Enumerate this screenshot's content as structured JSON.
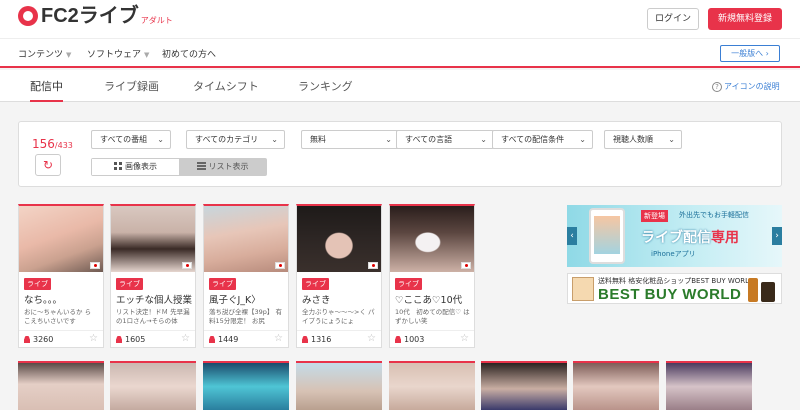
{
  "header": {
    "logo_main": "FC2ライブ",
    "logo_sub": "アダルト",
    "login_label": "ログイン",
    "register_label": "新規無料登録"
  },
  "nav": {
    "items": [
      {
        "label": "コンテンツ"
      },
      {
        "label": "ソフトウェア"
      },
      {
        "label": "初めての方へ"
      }
    ],
    "general_label": "一般版へ ›"
  },
  "tabs": [
    {
      "label": "配信中",
      "active": true
    },
    {
      "label": "ライブ録画"
    },
    {
      "label": "タイムシフト"
    },
    {
      "label": "ランキング"
    }
  ],
  "help_label": "アイコンの説明",
  "filters": {
    "count": "156",
    "total": "/433",
    "selects": [
      "すべての番組",
      "すべてのカテゴリ",
      "無料",
      "すべての言語",
      "すべての配信条件",
      "視聴人数順"
    ],
    "view_image_label": "画像表示",
    "view_list_label": "リスト表示"
  },
  "live_badge": "ライブ",
  "cards": [
    {
      "title": "なち。。。",
      "desc": "おに〜ちゃんいるか ら　こえちいさいです",
      "viewers": "3260"
    },
    {
      "title": "エッチな個人授業",
      "desc": "リスト決定！ドＭ 先早漏 の1ロさん→そらの体",
      "viewers": "1605"
    },
    {
      "title": "風子ぐJ_K〉",
      "desc": "落ち説び全裸【39p】 有料15分限定！ お尻",
      "viewers": "1449"
    },
    {
      "title": "みさき",
      "desc": "全力ぶりゃ〜〜〜>く パイプうにょうにょ",
      "viewers": "1316"
    },
    {
      "title": "♡ここあ♡10代",
      "desc": "10代　初めての配信♡ はずかしい笑",
      "viewers": "1003"
    }
  ],
  "ads": {
    "ad1_new": "新登場",
    "ad1_sub": "外出先でもお手軽配信",
    "ad1_main": "ライブ配信",
    "ad1_em": "専用",
    "ad1_app": "iPhoneアプリ",
    "ad2_top": "送料無料 格安化粧品ショップBEST BUY WORLD",
    "ad2_main": "BEST BUY WORLD"
  },
  "colors": {
    "accent": "#e8334a",
    "link": "#3b7fd4"
  }
}
